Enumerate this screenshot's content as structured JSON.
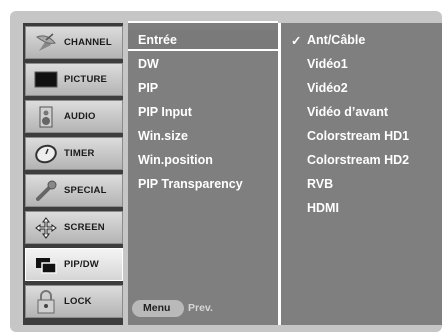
{
  "sidebar": {
    "items": [
      {
        "label": "CHANNEL",
        "icon": "satellite-dish-icon"
      },
      {
        "label": "PICTURE",
        "icon": "tv-screen-icon"
      },
      {
        "label": "AUDIO",
        "icon": "speaker-icon"
      },
      {
        "label": "TIMER",
        "icon": "clock-icon"
      },
      {
        "label": "SPECIAL",
        "icon": "wrench-icon"
      },
      {
        "label": "SCREEN",
        "icon": "move-arrows-icon"
      },
      {
        "label": "PIP/DW",
        "icon": "pip-window-icon",
        "active": true
      },
      {
        "label": "LOCK",
        "icon": "padlock-icon"
      }
    ]
  },
  "submenu": {
    "items": [
      "Entrée",
      "DW",
      "PIP",
      "PIP Input",
      "Win.size",
      "Win.position",
      "PIP Transparency"
    ],
    "selected_index": 0
  },
  "options": {
    "checkmark": "✓",
    "items": [
      "Ant/Câble",
      "Vidéo1",
      "Vidéo2",
      "Vidéo d’avant",
      "Colorstream HD1",
      "Colorstream HD2",
      "RVB",
      "HDMI"
    ],
    "checked_index": 0
  },
  "footer": {
    "menu_label": "Menu",
    "prev_label": "Prev."
  },
  "colors": {
    "panel_bg": "#7f7f7f",
    "osd_bg": "#c6c6c6",
    "text": "#ffffff"
  }
}
